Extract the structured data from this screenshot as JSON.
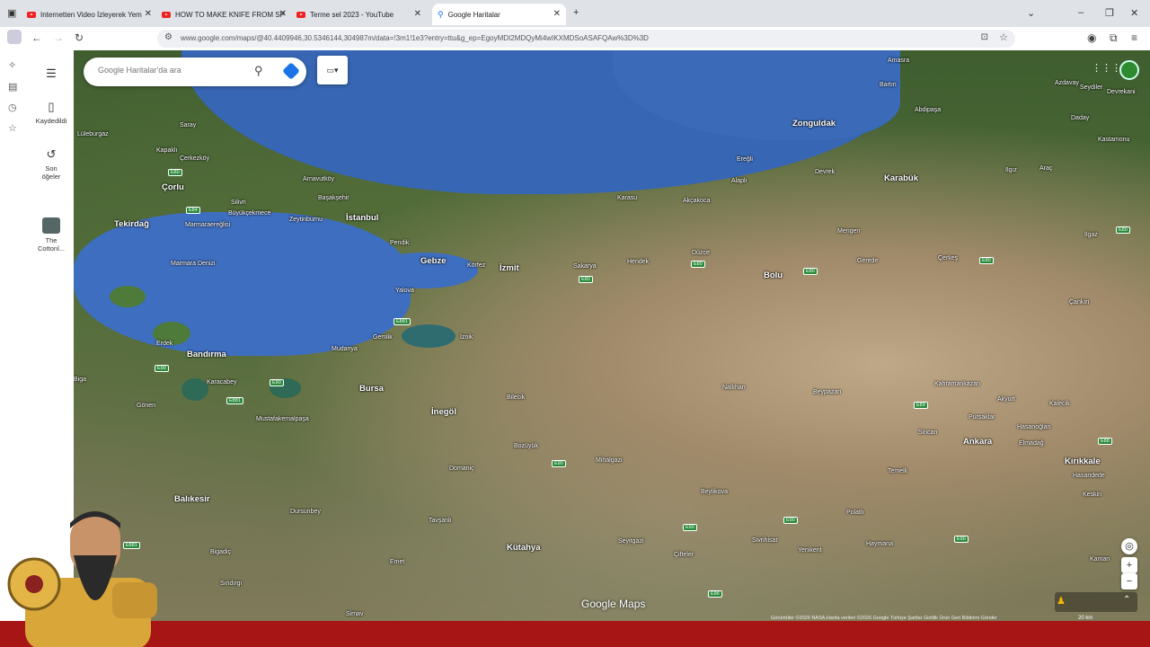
{
  "browser": {
    "tabs": [
      {
        "title": "Internetten Video İzleyerek Yem",
        "active": false
      },
      {
        "title": "HOW TO MAKE KNIFE FROM SP",
        "active": false
      },
      {
        "title": "Terme sel 2023 - YouTube",
        "active": false
      },
      {
        "title": "Google Haritalar",
        "active": true
      }
    ],
    "new_tab": "+",
    "url": "www.google.com/maps/@40.4409946,30.5346144,304987m/data=!3m1!1e3?entry=ttu&g_ep=EgoyMDI2MDQyMi4wIKXMDSoASAFQAw%3D%3D"
  },
  "maps": {
    "search_placeholder": "Google Haritalar'da ara",
    "saved_label": "Kaydedildi",
    "recent_label": "Son öğeler",
    "recent_place": "The Cottonl...",
    "logo": "Google Maps",
    "attribution": "Görüntüler ©2026 NASA,Harita verileri ©2026 Google   Türkiye   Şartlar   Gizlilik   Ürün Geri Bildirimi Gönder",
    "scale": "20 km"
  },
  "places": [
    {
      "name": "Amasra"
    },
    {
      "name": "Zonguldak",
      "big": true
    },
    {
      "name": "Bartın"
    },
    {
      "name": "Abdipaşa"
    },
    {
      "name": "Azdavay"
    },
    {
      "name": "Seydiler"
    },
    {
      "name": "Devrekani"
    },
    {
      "name": "Daday"
    },
    {
      "name": "Kastamonu"
    },
    {
      "name": "Ereğli"
    },
    {
      "name": "Alaplı"
    },
    {
      "name": "Devrek"
    },
    {
      "name": "Karabük",
      "big": true
    },
    {
      "name": "Ilgız"
    },
    {
      "name": "Araç"
    },
    {
      "name": "Akçakoca"
    },
    {
      "name": "Karasu"
    },
    {
      "name": "Mengen"
    },
    {
      "name": "Ilgaz"
    },
    {
      "name": "Lüleburgaz"
    },
    {
      "name": "Saray"
    },
    {
      "name": "Kapaklı"
    },
    {
      "name": "Çerkezköy"
    },
    {
      "name": "Çorlu",
      "big": true
    },
    {
      "name": "Arnavutköy"
    },
    {
      "name": "Başakşehir"
    },
    {
      "name": "Silivri"
    },
    {
      "name": "Büyükçekmece"
    },
    {
      "name": "İstanbul",
      "big": true
    },
    {
      "name": "Zeytinburnu"
    },
    {
      "name": "Tekirdağ",
      "big": true
    },
    {
      "name": "Marmaraereğlisi"
    },
    {
      "name": "Marmara Denizi"
    },
    {
      "name": "Pendik"
    },
    {
      "name": "Gebze",
      "big": true
    },
    {
      "name": "Körfez"
    },
    {
      "name": "İzmit",
      "big": true
    },
    {
      "name": "Sakarya"
    },
    {
      "name": "Hendek"
    },
    {
      "name": "Düzce"
    },
    {
      "name": "Bolu",
      "big": true
    },
    {
      "name": "Gerede"
    },
    {
      "name": "Çerkeş"
    },
    {
      "name": "Yalova"
    },
    {
      "name": "Çankırı"
    },
    {
      "name": "Gemlik"
    },
    {
      "name": "İznik"
    },
    {
      "name": "Erdek"
    },
    {
      "name": "Bandırma",
      "big": true
    },
    {
      "name": "Mudanya"
    },
    {
      "name": "Bursa",
      "big": true
    },
    {
      "name": "Karacabey"
    },
    {
      "name": "Biga"
    },
    {
      "name": "Gönen"
    },
    {
      "name": "İnegöl",
      "big": true
    },
    {
      "name": "Bilecik"
    },
    {
      "name": "Nallıhan"
    },
    {
      "name": "Beypazarı"
    },
    {
      "name": "Kahramankazan"
    },
    {
      "name": "Akyurt"
    },
    {
      "name": "Kalecik"
    },
    {
      "name": "Pursaklar"
    },
    {
      "name": "Hasanoğlan"
    },
    {
      "name": "Sincan"
    },
    {
      "name": "Ankara",
      "big": true
    },
    {
      "name": "Elmadağ"
    },
    {
      "name": "Kırıkkale",
      "big": true
    },
    {
      "name": "Hasandede"
    },
    {
      "name": "Mustafakemalpaşa"
    },
    {
      "name": "Bozüyük"
    },
    {
      "name": "Mihalgazi"
    },
    {
      "name": "Domaniç"
    },
    {
      "name": "Balıkesir",
      "big": true
    },
    {
      "name": "Dursunbey"
    },
    {
      "name": "Beylikova"
    },
    {
      "name": "Polatlı"
    },
    {
      "name": "Temelli"
    },
    {
      "name": "Keskin"
    },
    {
      "name": "Tavşanlı"
    },
    {
      "name": "Kütahya",
      "big": true
    },
    {
      "name": "Seyitgazi"
    },
    {
      "name": "Sivrihisar"
    },
    {
      "name": "Yenikent"
    },
    {
      "name": "Haymana"
    },
    {
      "name": "Kaman"
    },
    {
      "name": "Bigadiç"
    },
    {
      "name": "Emet"
    },
    {
      "name": "Çifteler"
    },
    {
      "name": "Sındırgı"
    },
    {
      "name": "Simav"
    }
  ]
}
